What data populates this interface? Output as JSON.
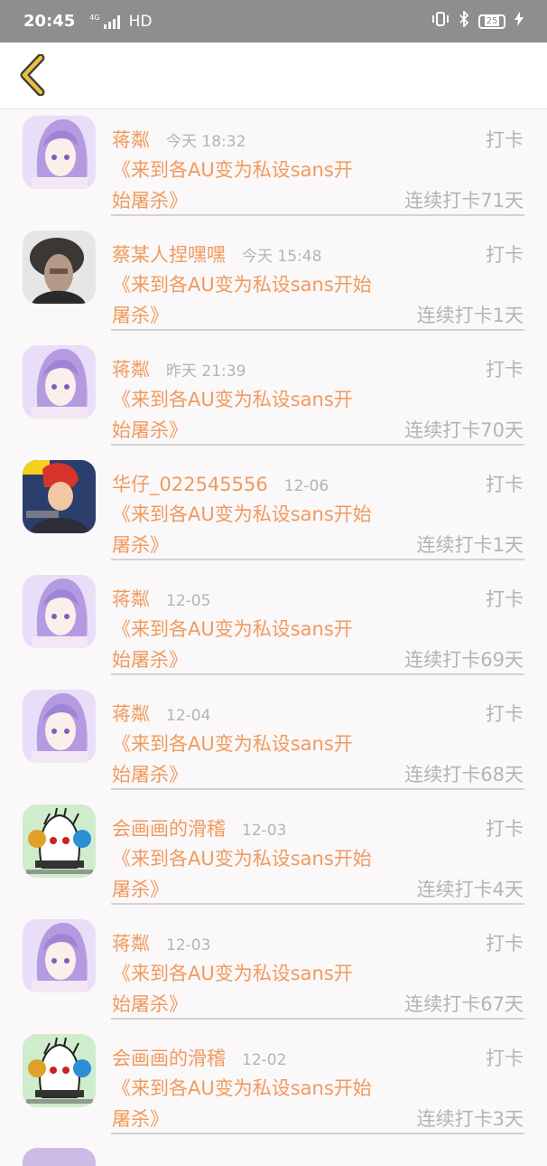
{
  "status_bar": {
    "time": "20:45",
    "network": "HD",
    "signal_type": "4G",
    "battery": "25"
  },
  "feed": [
    {
      "name": "蒋粼",
      "time": "今天 18:32",
      "action": "打卡",
      "title_line1": "《来到各AU变为私设sans开",
      "title_line2": "始屠杀》",
      "streak": "连续打卡71天",
      "avatar": "anime-girl"
    },
    {
      "name": "蔡某人捏嘿嘿",
      "time": "今天 15:48",
      "action": "打卡",
      "title_line1": "《来到各AU变为私设sans开始",
      "title_line2": "屠杀》",
      "streak": "连续打卡1天",
      "avatar": "photo"
    },
    {
      "name": "蒋粼",
      "time": "昨天 21:39",
      "action": "打卡",
      "title_line1": "《来到各AU变为私设sans开",
      "title_line2": "始屠杀》",
      "streak": "连续打卡70天",
      "avatar": "anime-girl"
    },
    {
      "name": "华仔_022545556",
      "time": "12-06",
      "action": "打卡",
      "title_line1": "《来到各AU变为私设sans开始",
      "title_line2": "屠杀》",
      "streak": "连续打卡1天",
      "avatar": "game-hero"
    },
    {
      "name": "蒋粼",
      "time": "12-05",
      "action": "打卡",
      "title_line1": "《来到各AU变为私设sans开",
      "title_line2": "始屠杀》",
      "streak": "连续打卡69天",
      "avatar": "anime-girl"
    },
    {
      "name": "蒋粼",
      "time": "12-04",
      "action": "打卡",
      "title_line1": "《来到各AU变为私设sans开",
      "title_line2": "始屠杀》",
      "streak": "连续打卡68天",
      "avatar": "anime-girl"
    },
    {
      "name": "会画画的滑稽",
      "time": "12-03",
      "action": "打卡",
      "title_line1": "《来到各AU变为私设sans开始",
      "title_line2": "屠杀》",
      "streak": "连续打卡4天",
      "avatar": "doodle"
    },
    {
      "name": "蒋粼",
      "time": "12-03",
      "action": "打卡",
      "title_line1": "《来到各AU变为私设sans开",
      "title_line2": "始屠杀》",
      "streak": "连续打卡67天",
      "avatar": "anime-girl"
    },
    {
      "name": "会画画的滑稽",
      "time": "12-02",
      "action": "打卡",
      "title_line1": "《来到各AU变为私设sans开始",
      "title_line2": "屠杀》",
      "streak": "连续打卡3天",
      "avatar": "doodle"
    }
  ],
  "colors": {
    "accent": "#f09a5e",
    "muted": "#b4b4b4",
    "status_bar": "#8e8e8e",
    "back_arrow": "#e8c23a"
  }
}
